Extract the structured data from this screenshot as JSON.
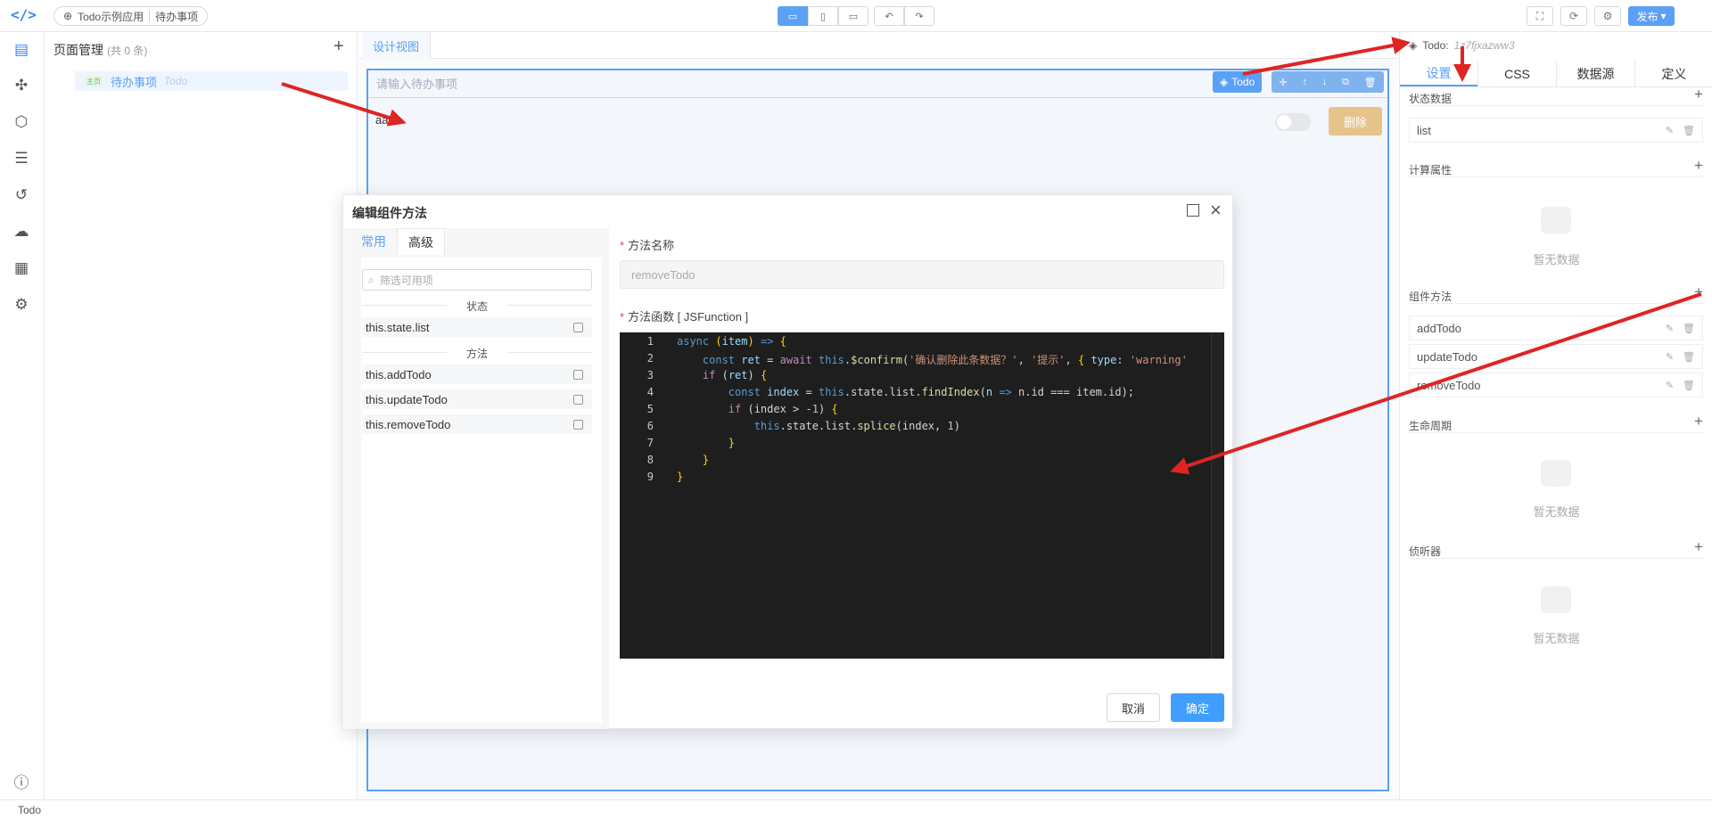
{
  "topbar": {
    "app_name": "Todo示例应用",
    "page_name": "待办事项",
    "publish_label": "发布"
  },
  "page_panel": {
    "title": "页面管理",
    "count": "(共 0 条)",
    "item": {
      "badge": "主页",
      "name": "待办事项",
      "id": "Todo"
    }
  },
  "design": {
    "tab_label": "设计视图",
    "input_placeholder": "请输入待办事项",
    "row_text": "aa",
    "delete_label": "删除",
    "component_tag": "Todo"
  },
  "right_panel": {
    "component": "Todo:",
    "component_id": "1z7fjxazww3",
    "tabs": [
      "设置",
      "CSS",
      "数据源",
      "定义"
    ],
    "sections": {
      "state": "状态数据",
      "computed": "计算属性",
      "methods": "组件方法",
      "lifecycle": "生命周期",
      "watchers": "侦听器"
    },
    "state_items": [
      "list"
    ],
    "method_items": [
      "addTodo",
      "updateTodo",
      "removeTodo"
    ],
    "empty_text": "暂无数据"
  },
  "footer": {
    "text": "Todo"
  },
  "modal": {
    "title": "编辑组件方法",
    "tabs": [
      "常用",
      "高级"
    ],
    "search_placeholder": "筛选可用项",
    "group_state": "状态",
    "state_options": [
      "this.state.list"
    ],
    "group_methods": "方法",
    "method_options": [
      "this.addTodo",
      "this.updateTodo",
      "this.removeTodo"
    ],
    "name_label": "方法名称",
    "name_value": "removeTodo",
    "func_label": "方法函数 [ JSFunction ]",
    "line_numbers": [
      "1",
      "2",
      "3",
      "4",
      "5",
      "6",
      "7",
      "8",
      "9"
    ],
    "cancel_label": "取消",
    "ok_label": "确定"
  },
  "colors": {
    "accent": "#5aa0f5",
    "arrow": "#e02424",
    "delete": "#e6c38b"
  }
}
